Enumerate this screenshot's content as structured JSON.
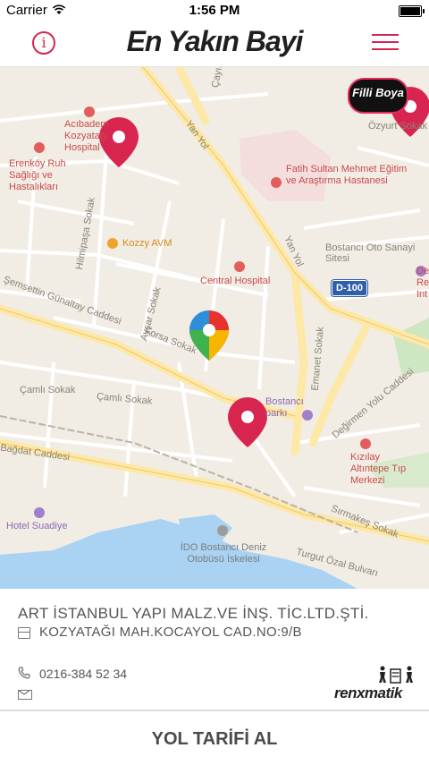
{
  "status_bar": {
    "carrier": "Carrier",
    "time": "1:56 PM"
  },
  "nav": {
    "title": "En Yakın Bayi",
    "info_icon": "info-icon",
    "menu_icon": "hamburger-menu-icon",
    "accent_color": "#d8254f"
  },
  "map": {
    "streets": [
      "Çayır",
      "Yan Yol",
      "Yan Yol",
      "Hilmipaşa Sokak",
      "Şemsettin Günaltay Caddesi",
      "Ayşar Sokak",
      "Forsa Sokak",
      "Çamlı Sokak",
      "Çamlı Sokak",
      "Bağdat Caddesi",
      "Emanet Sokak",
      "Değirmen Yolu Caddesi",
      "Sırmakeş Sokak",
      "Turgut Özal Bulvarı",
      "Özyurt Sokak",
      "Bostancı Oto Sanayi Sitesi"
    ],
    "pois": {
      "acibadem": "Acıbadem Kozyatağı Hospital",
      "erenkoy": "Erenköy Ruh Sağlığı ve Hastalıkları",
      "fatih": "Fatih Sultan Mehmet Eğitim ve Araştırma Hastanesi",
      "kozzy": "Kozzy AVM",
      "central": "Central Hospital",
      "bostanci_park": "Bostancı parkı",
      "kizilay": "Kızılay Altıntepe Tıp Merkezi",
      "hotel": "Hotel Suadiye",
      "ido": "İDO Bostancı Deniz Otobüsü İskelesi",
      "de_re": "De Re Int"
    },
    "highway_shield": "D-100",
    "brand_logo": "Filli Boya"
  },
  "dealer": {
    "name": "ART İSTANBUL YAPI MALZ.VE İNŞ. TİC.LTD.ŞTİ.",
    "address": "KOZYATAĞI MAH.KOCAYOL CAD.NO:9/B",
    "phone": "0216-384 52 34",
    "partner_logo": "renxmatik"
  },
  "route_button": {
    "label": "YOL TARİFİ AL"
  }
}
